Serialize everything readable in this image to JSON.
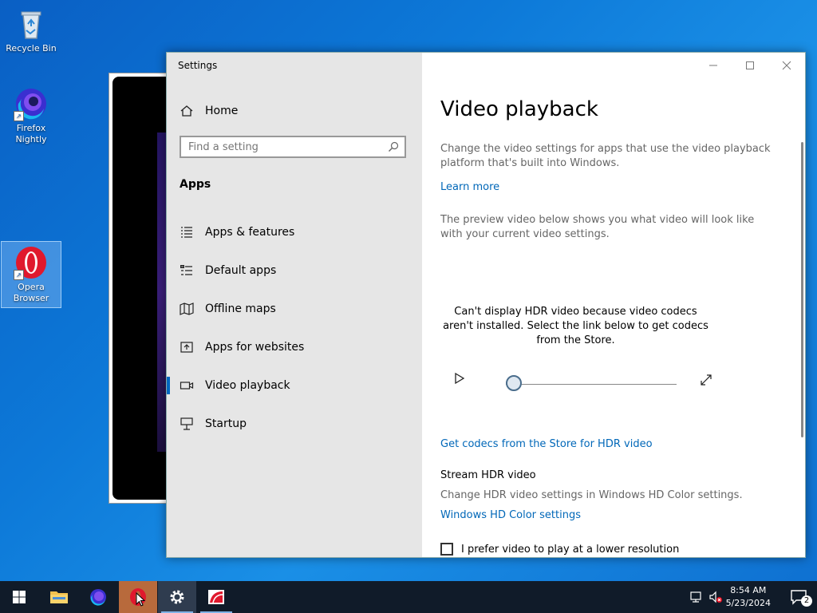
{
  "desktop": {
    "icons": [
      {
        "label": "Recycle Bin"
      },
      {
        "label": "Firefox\nNightly"
      },
      {
        "label": "Opera\nBrowser"
      }
    ]
  },
  "settings": {
    "window_title": "Settings",
    "nav": {
      "home": "Home",
      "search_placeholder": "Find a setting",
      "section": "Apps",
      "items": [
        {
          "label": "Apps & features",
          "icon": "list-icon"
        },
        {
          "label": "Default apps",
          "icon": "default-apps-icon"
        },
        {
          "label": "Offline maps",
          "icon": "map-icon"
        },
        {
          "label": "Apps for websites",
          "icon": "open-external-icon"
        },
        {
          "label": "Video playback",
          "icon": "video-icon",
          "active": true
        },
        {
          "label": "Startup",
          "icon": "startup-icon"
        }
      ]
    },
    "content": {
      "title": "Video playback",
      "description": "Change the video settings for apps that use the video playback platform that's built into Windows.",
      "learn_more": "Learn more",
      "preview_text": "The preview video below shows you what video will look like with your current video settings.",
      "hdr_notice": "Can't display HDR video because video codecs aren't installed. Select the link below to get codecs from the Store.",
      "codecs_link": "Get codecs from the Store for HDR video",
      "stream_hdr_title": "Stream HDR video",
      "stream_hdr_desc": "Change HDR video settings in Windows HD Color settings.",
      "hd_color_link": "Windows HD Color settings",
      "lower_res_label": "I prefer video to play at a lower resolution",
      "playback_progress": 0
    }
  },
  "taskbar": {
    "time": "8:54 AM",
    "date": "5/23/2024",
    "notification_count": "2"
  }
}
